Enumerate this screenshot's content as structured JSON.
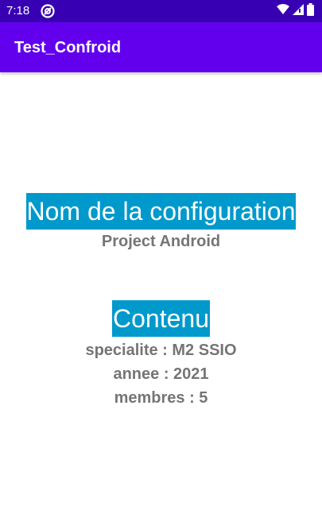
{
  "status_bar": {
    "time": "7:18",
    "app_icon": "at-sign-icon",
    "icons": [
      "wifi-icon",
      "signal-icon",
      "battery-icon"
    ],
    "background": "#3700b3"
  },
  "app_bar": {
    "title": "Test_Confroid",
    "background": "#6200ee"
  },
  "configuration": {
    "heading": "Nom de la configuration",
    "name": "Project Android"
  },
  "contenu": {
    "heading": "Contenu",
    "lines": [
      "specialite : M2 SSIO",
      "annee : 2021",
      "membres : 5"
    ]
  },
  "colors": {
    "heading_highlight": "#0099cc",
    "body_text": "#757575"
  }
}
